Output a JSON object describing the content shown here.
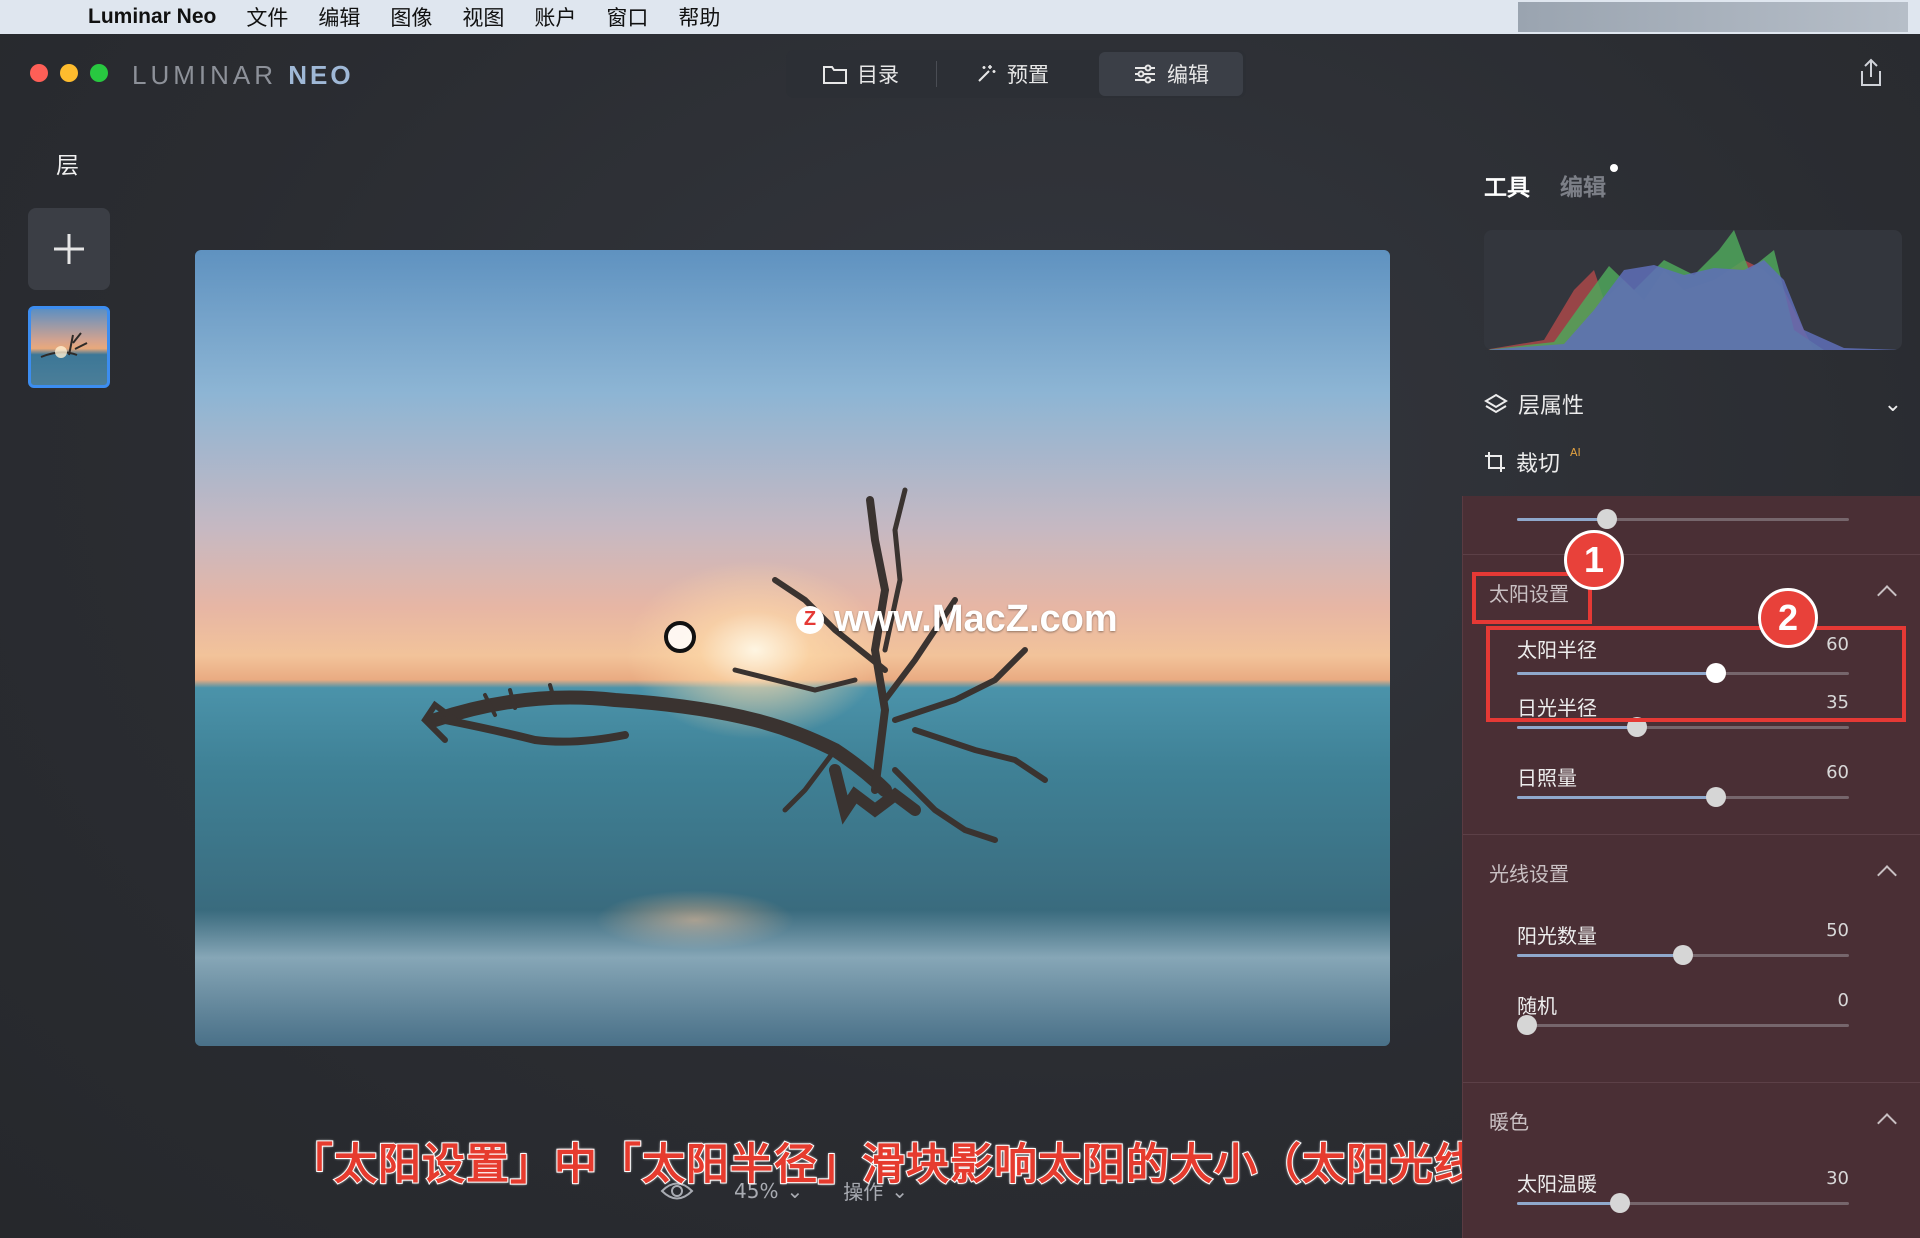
{
  "menubar": {
    "app_name": "Luminar Neo",
    "items": [
      "文件",
      "编辑",
      "图像",
      "视图",
      "账户",
      "窗口",
      "帮助"
    ]
  },
  "titlebar": {
    "logo_main": "LUMINAR",
    "logo_neo": "NEO",
    "tabs": [
      {
        "label": "目录",
        "icon": "folder-icon"
      },
      {
        "label": "预置",
        "icon": "magic-wand-icon"
      },
      {
        "label": "编辑",
        "icon": "sliders-icon",
        "active": true
      }
    ]
  },
  "left_panel": {
    "title": "层"
  },
  "photo": {
    "watermark": "www.MacZ.com",
    "watermark_badge": "Z"
  },
  "bottom_bar": {
    "zoom": "45%",
    "actions": "操作"
  },
  "caption": "「太阳设置」中「太阳半径」滑块影响太阳的大小（太阳光线的原点）",
  "right_panel": {
    "tabs": {
      "tools": "工具",
      "edits": "编辑"
    },
    "sections": {
      "layer_properties": "层属性",
      "crop": "裁切",
      "crop_badge": "AI"
    },
    "groups": [
      {
        "title": "太阳设置",
        "sliders": [
          {
            "label": "太阳半径",
            "value": "60",
            "fraction": 0.6
          },
          {
            "label": "日光半径",
            "value": "35",
            "fraction": 0.36
          },
          {
            "label": "日照量",
            "value": "60",
            "fraction": 0.6
          }
        ]
      },
      {
        "title": "光线设置",
        "sliders": [
          {
            "label": "阳光数量",
            "value": "50",
            "fraction": 0.5
          },
          {
            "label": "随机",
            "value": "0",
            "fraction": 0.03
          }
        ]
      },
      {
        "title": "暖色",
        "sliders": [
          {
            "label": "太阳温暖",
            "value": "30",
            "fraction": 0.31
          }
        ]
      }
    ],
    "top_slider_fraction": 0.27
  },
  "annotations": {
    "badge1": "1",
    "badge2": "2"
  },
  "colors": {
    "accent_red": "#e53935",
    "panel_bg": "#4a2f35",
    "slider_fill": "#8fa8cc"
  }
}
